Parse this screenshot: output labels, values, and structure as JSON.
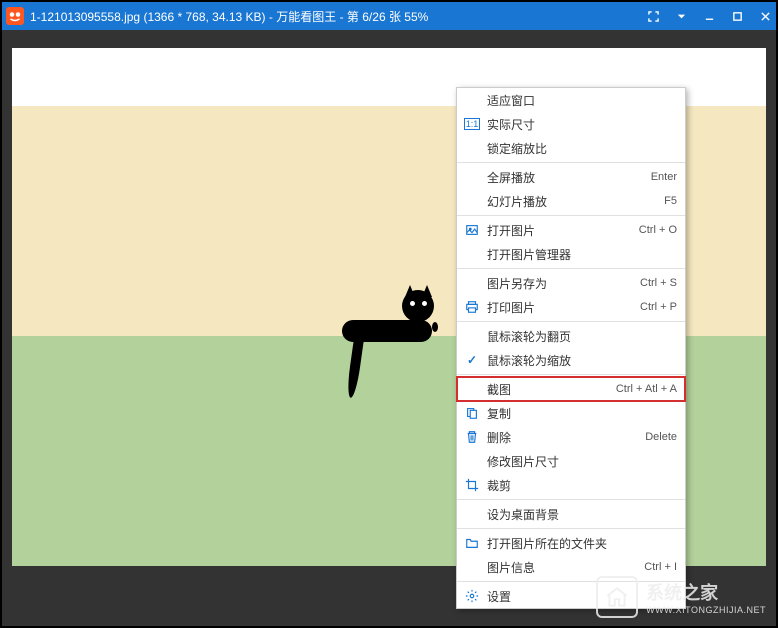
{
  "titlebar": {
    "filename": "1-121013095558.jpg",
    "dimensions": "(1366 * 768, 34.13 KB)",
    "app_sep": " - ",
    "app_name": "万能看图王",
    "position_info": " - 第 6/26 张 55%"
  },
  "menu": {
    "fit_window": "适应窗口",
    "actual_size": "实际尺寸",
    "lock_zoom": "锁定缩放比",
    "fullscreen_play": "全屏播放",
    "fullscreen_play_sc": "Enter",
    "slideshow": "幻灯片播放",
    "slideshow_sc": "F5",
    "open_image": "打开图片",
    "open_image_sc": "Ctrl + O",
    "open_manager": "打开图片管理器",
    "save_as": "图片另存为",
    "save_as_sc": "Ctrl + S",
    "print": "打印图片",
    "print_sc": "Ctrl + P",
    "scroll_page": "鼠标滚轮为翻页",
    "scroll_zoom": "鼠标滚轮为缩放",
    "screenshot": "截图",
    "screenshot_sc": "Ctrl + Atl + A",
    "copy": "复制",
    "delete": "删除",
    "delete_sc": "Delete",
    "modify_size": "修改图片尺寸",
    "crop": "裁剪",
    "set_wallpaper": "设为桌面背景",
    "open_folder": "打开图片所在的文件夹",
    "image_info": "图片信息",
    "image_info_sc": "Ctrl + I",
    "settings": "设置"
  },
  "watermark": {
    "name_cn": "系统之家",
    "name_en": "WWW.XITONGZHIJIA.NET"
  }
}
